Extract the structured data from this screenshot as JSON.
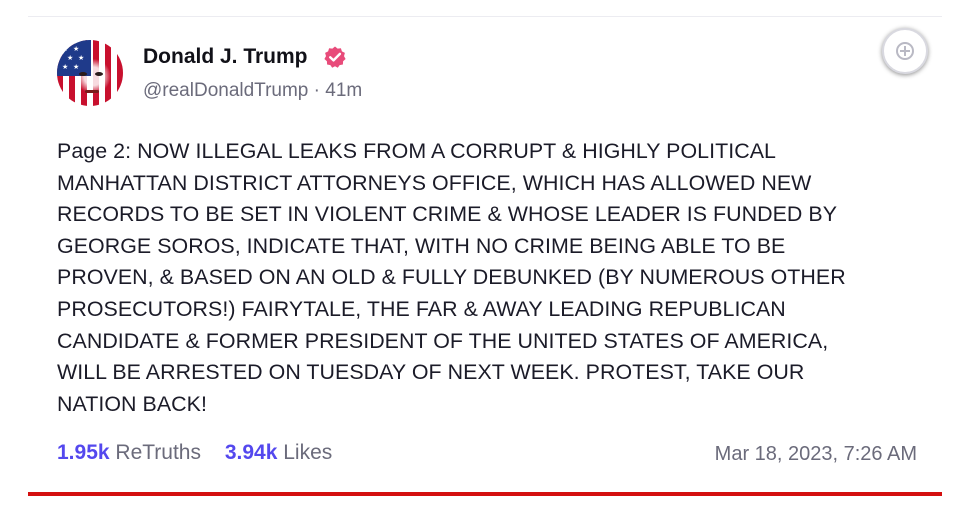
{
  "author": {
    "name": "Donald J. Trump",
    "handle": "@realDonaldTrump",
    "separator": "·",
    "time_ago": "41m",
    "verified": true
  },
  "post": {
    "lines": [
      "Page 2: NOW ILLEGAL LEAKS FROM A CORRUPT & HIGHLY POLITICAL",
      "MANHATTAN DISTRICT ATTORNEYS OFFICE, WHICH HAS ALLOWED NEW",
      "RECORDS TO BE SET IN VIOLENT CRIME & WHOSE LEADER IS FUNDED BY",
      "GEORGE SOROS, INDICATE THAT, WITH NO CRIME BEING ABLE TO BE",
      "PROVEN, & BASED ON AN OLD & FULLY DEBUNKED (BY NUMEROUS OTHER",
      "PROSECUTORS!) FAIRYTALE, THE FAR & AWAY LEADING REPUBLICAN",
      "CANDIDATE & FORMER PRESIDENT OF THE UNITED STATES OF AMERICA,",
      "WILL BE ARRESTED ON TUESDAY OF NEXT WEEK. PROTEST, TAKE OUR",
      "NATION BACK!"
    ]
  },
  "stats": {
    "retruths_count": "1.95k",
    "retruths_label": "ReTruths",
    "likes_count": "3.94k",
    "likes_label": "Likes"
  },
  "timestamp": "Mar 18, 2023, 7:26 AM",
  "icons": {
    "verified": "verified-badge-icon",
    "add": "plus-circle-icon"
  },
  "colors": {
    "accent": "#5448ee",
    "verified": "#e84b7a",
    "divider": "#d40f0f"
  }
}
